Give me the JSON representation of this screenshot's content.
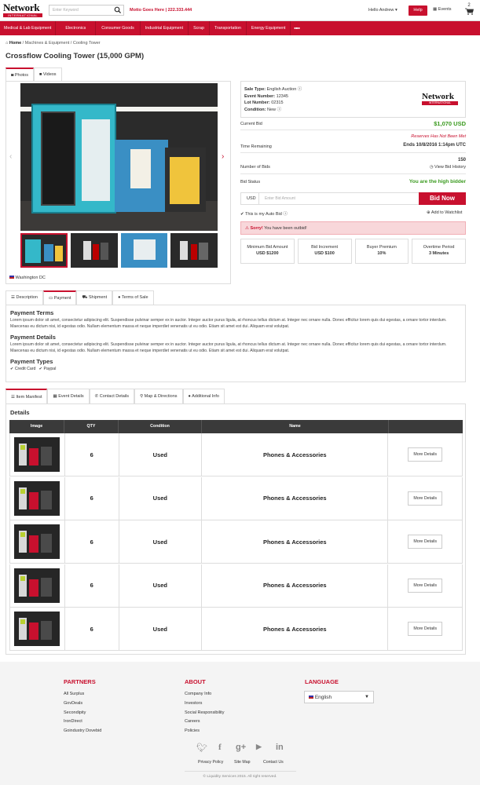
{
  "header": {
    "logo_word": "Network",
    "logo_band": "INTERNATIONAL",
    "search_placeholder": "Enter Keyword",
    "motto": "Motto Goes Here | 222.333.444",
    "greeting": "Hello Andrew",
    "help": "Help",
    "events": "Events",
    "cart_count": "2"
  },
  "nav": [
    "Medical & Lab Equipment",
    "Electronics",
    "Consumer Goods",
    "Industrial Equipment",
    "Scrap",
    "Transportation",
    "Energy Equipment",
    "■■■"
  ],
  "breadcrumb": {
    "home": "Home",
    "rest": " / Machines & Equipment / Cooling Tower"
  },
  "title": "Crossflow Cooling Tower (15,000 GPM)",
  "media_tabs": [
    "Photos",
    "Videos"
  ],
  "gallery": {
    "location": "Washington DC"
  },
  "lot_info": {
    "sale_type_label": "Sale Type:",
    "sale_type": "English Auction",
    "event_label": "Event Number:",
    "event": "12345",
    "lot_label": "Lot Number:",
    "lot": "02315",
    "condition_label": "Condition:",
    "condition": "New"
  },
  "bid": {
    "current_bid_label": "Current Bid",
    "current_bid": "$1,070 USD",
    "reserve": "Reserves Has Not Been Met",
    "time_label": "Time Remaining",
    "ends": "Ends 10/8/2016 1:14pm UTC",
    "bids_label": "Number of Bids",
    "bids": "150",
    "history": "View Bid History",
    "status_label": "Bid Status",
    "status": "You are the high bidder",
    "currency": "USD",
    "amount_placeholder": "Enter Bid Amount",
    "bid_now": "Bid Now",
    "auto_bid": "This is my Auto Bid",
    "watchlist": "Add to Watchlist",
    "alert_bold": "Sorry!",
    "alert_text": " You have been outbid!"
  },
  "stats": [
    {
      "label": "Minimum Bid Amount",
      "value": "USD $1200"
    },
    {
      "label": "Bid Increment",
      "value": "USD $100"
    },
    {
      "label": "Buyer Premium",
      "value": "10%"
    },
    {
      "label": "Overtime Period",
      "value": "3 Minutes"
    }
  ],
  "desc_tabs": [
    "Description",
    "Payment",
    "Shipment",
    "Terms of Sale"
  ],
  "payment": {
    "terms_title": "Payment Terms",
    "terms_text": "Lorem ipsum dolor sit amet, consectetur adipiscing elit. Suspendisse pulvinar semper ex in auctor. Integer auctor purus ligula, at rhoncus tellus dictum at. Integer nec ornare nulla. Donec efficitur lorem quis dui egestas, a ornare tortor interdum. Maecenas eu dictum nisi, id egestas odio. Nullam elementum massa et neque imperdiet venenatis ut eu odio. Etiam sit amet est dui. Aliquam erat volutpat.",
    "details_title": "Payment Details",
    "details_text": "Lorem ipsum dolor sit amet, consectetur adipiscing elit. Suspendisse pulvinar semper ex in auctor. Integer auctor purus ligula, at rhoncus tellus dictum at. Integer nec ornare nulla. Donec efficitur lorem quis dui egestas, a ornare tortor interdum. Maecenas eu dictum nisi, id egestas odio. Nullam elementum massa et neque imperdiet venenatis ut eu odio. Etiam sit amet est dui. Aliquam erat volutpat.",
    "types_title": "Payment Types",
    "types": [
      "Credit Card",
      "Paypal"
    ]
  },
  "info_tabs": [
    "Item Manifest",
    "Event Details",
    "Contact Details",
    "Map & Directions",
    "Additional Info"
  ],
  "manifest": {
    "title": "Details",
    "columns": [
      "Image",
      "QTY",
      "Condition",
      "Name",
      ""
    ],
    "rows": [
      {
        "qty": "6",
        "condition": "Used",
        "name": "Phones & Accessories",
        "action": "More Details"
      },
      {
        "qty": "6",
        "condition": "Used",
        "name": "Phones & Accessories",
        "action": "More Details"
      },
      {
        "qty": "6",
        "condition": "Used",
        "name": "Phones & Accessories",
        "action": "More Details"
      },
      {
        "qty": "6",
        "condition": "Used",
        "name": "Phones & Accessories",
        "action": "More Details"
      },
      {
        "qty": "6",
        "condition": "Used",
        "name": "Phones & Accessories",
        "action": "More Details"
      }
    ]
  },
  "footer": {
    "partners_title": "PARTNERS",
    "partners": [
      "All Surplus",
      "GovDeals",
      "Secondipity",
      "IronDirect",
      "Goindustry Dovebid"
    ],
    "about_title": "ABOUT",
    "about": [
      "Company Info",
      "Investors",
      "Social Responsibility",
      "Careers",
      "Policies"
    ],
    "language_title": "LANGUAGE",
    "language": "English",
    "social": [
      "twitter-icon",
      "facebook-icon",
      "google-plus-icon",
      "youtube-icon",
      "linkedin-icon"
    ],
    "links": [
      "Privacy Policy",
      "Site Map",
      "Contact Us"
    ],
    "copyright": "© Liquidity Services 2015. All right reserved."
  },
  "colors": {
    "brand_red": "#c8102e",
    "green": "#3a9a1e"
  }
}
